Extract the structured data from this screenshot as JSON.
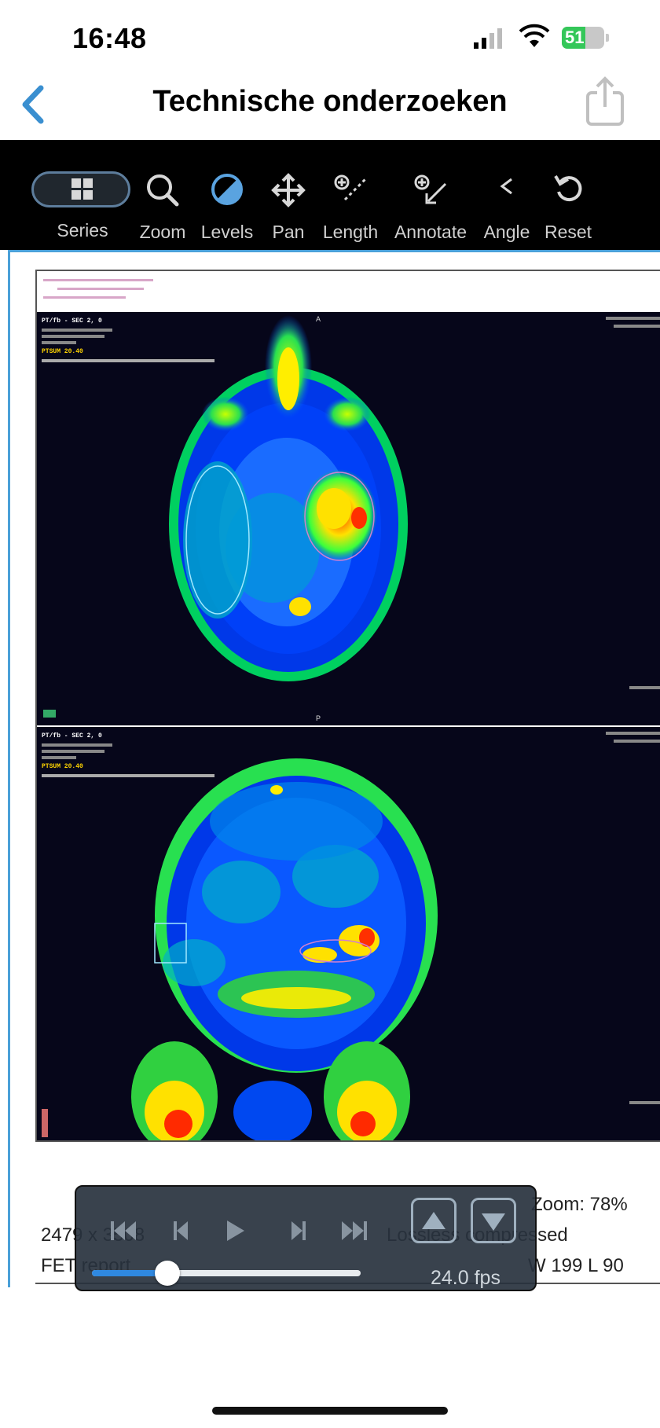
{
  "status_bar": {
    "time": "16:48",
    "battery": "51"
  },
  "nav": {
    "title": "Technische onderzoeken",
    "back_icon": "chevron-left-icon",
    "share_icon": "share-icon"
  },
  "toolbar": {
    "items": [
      {
        "label": "Series",
        "icon": "grid-icon",
        "active": false
      },
      {
        "label": "Zoom",
        "icon": "search-icon",
        "active": false
      },
      {
        "label": "Levels",
        "icon": "contrast-icon",
        "active": true
      },
      {
        "label": "Pan",
        "icon": "move-icon",
        "active": false
      },
      {
        "label": "Length",
        "icon": "ruler-icon",
        "active": false
      },
      {
        "label": "Annotate",
        "icon": "annotate-icon",
        "active": false
      },
      {
        "label": "Angle",
        "icon": "angle-icon",
        "active": false
      },
      {
        "label": "Reset",
        "icon": "reset-icon",
        "active": false
      }
    ]
  },
  "scan": {
    "top_marker": "A",
    "bottom_marker": "P",
    "top": {
      "series": "PT/fb - SEC 2, 0",
      "petsum": "PTSUM 20.40"
    },
    "bottom": {
      "series": "PT/fb - SEC 2, 0",
      "petsum": "PTSUM 20.40"
    }
  },
  "info": {
    "dimensions": "2479 x 3508",
    "title": "FET report",
    "compression": "Lossless compressed",
    "zoom": "Zoom: 78%",
    "window_level": "W 199 L 90"
  },
  "player": {
    "fps": "24.0 fps",
    "progress": 0.28
  },
  "colors": {
    "accent": "#4aa0d8",
    "toolbar_bg": "#000000",
    "battery": "#34c759"
  }
}
